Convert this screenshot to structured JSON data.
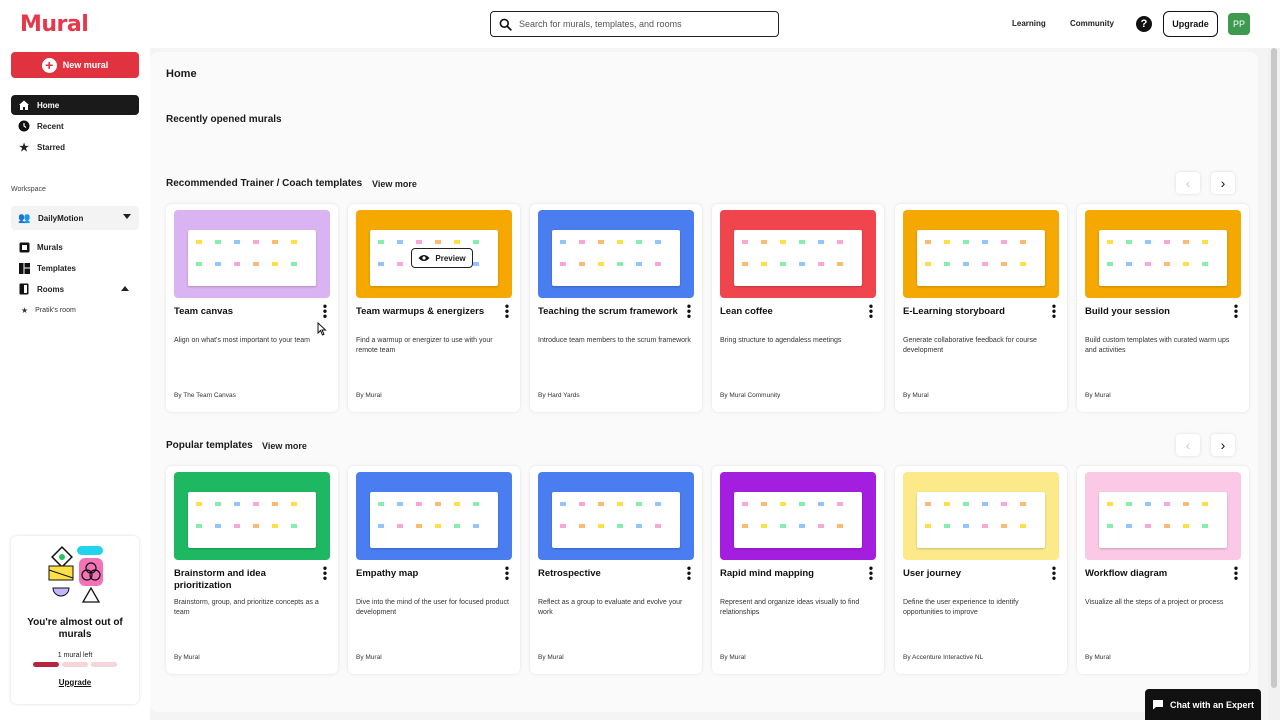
{
  "app": {
    "logo": "Mural"
  },
  "search": {
    "placeholder": "Search for murals, templates, and rooms"
  },
  "topnav": {
    "learning": "Learning",
    "community": "Community",
    "help": "?",
    "upgrade": "Upgrade",
    "avatar": "PP"
  },
  "sidebar": {
    "new_mural": "New mural",
    "nav": [
      {
        "label": "Home",
        "icon": "home-icon"
      },
      {
        "label": "Recent",
        "icon": "clock-icon"
      },
      {
        "label": "Starred",
        "icon": "star-icon"
      }
    ],
    "workspace_label": "Workspace",
    "workspace_name": "DailyMotion",
    "ws_nav": [
      {
        "label": "Murals",
        "icon": "murals-icon"
      },
      {
        "label": "Templates",
        "icon": "templates-icon"
      },
      {
        "label": "Rooms",
        "icon": "rooms-icon"
      }
    ],
    "room": "Pratik's room",
    "promo": {
      "title": "You're almost out of murals",
      "sub": "1 mural left",
      "murals_used_fraction": 0.33,
      "link": "Upgrade"
    }
  },
  "main": {
    "title": "Home",
    "recent_title": "Recently opened murals",
    "recommended": {
      "title": "Recommended Trainer / Coach templates",
      "view_more": "View more",
      "preview_label": "Preview",
      "cards": [
        {
          "name": "Team canvas",
          "desc": "Align on what's most important to your team",
          "by": "By The Team Canvas",
          "color": "#d9b3f2"
        },
        {
          "name": "Team warmups & energizers",
          "desc": "Find a warmup or energizer to use with your remote team",
          "by": "By Mural",
          "color": "#f5a800"
        },
        {
          "name": "Teaching the scrum framework",
          "desc": "Introduce team members to the scrum framework",
          "by": "By Hard Yards",
          "color": "#4a7df0"
        },
        {
          "name": "Lean coffee",
          "desc": "Bring structure to agendaless meetings",
          "by": "By Mural Community",
          "color": "#f0454d"
        },
        {
          "name": "E-Learning storyboard",
          "desc": "Generate collaborative feedback for course development",
          "by": "By Mural",
          "color": "#f5a800"
        },
        {
          "name": "Build your session",
          "desc": "Build custom templates with curated warm ups and activities",
          "by": "By Mural",
          "color": "#f5a800"
        }
      ]
    },
    "popular": {
      "title": "Popular templates",
      "view_more": "View more",
      "cards": [
        {
          "name": "Brainstorm and idea prioritization",
          "desc": "Brainstorm, group, and prioritize concepts as a team",
          "by": "By Mural",
          "color": "#1fb862"
        },
        {
          "name": "Empathy map",
          "desc": "Dive into the mind of the user for focused product development",
          "by": "By Mural",
          "color": "#4a7df0"
        },
        {
          "name": "Retrospective",
          "desc": "Reflect as a group to evaluate and evolve your work",
          "by": "By Mural",
          "color": "#4a7df0"
        },
        {
          "name": "Rapid mind mapping",
          "desc": "Represent and organize ideas visually to find relationships",
          "by": "By Mural",
          "color": "#a41ee0"
        },
        {
          "name": "User journey",
          "desc": "Define the user experience to identify opportunities to improve",
          "by": "By Accenture Interactive NL",
          "color": "#fbe98a"
        },
        {
          "name": "Workflow diagram",
          "desc": "Visualize all the steps of a project or process",
          "by": "By Mural",
          "color": "#fbc8e6"
        }
      ]
    }
  },
  "chat": {
    "label": "Chat with an Expert"
  }
}
